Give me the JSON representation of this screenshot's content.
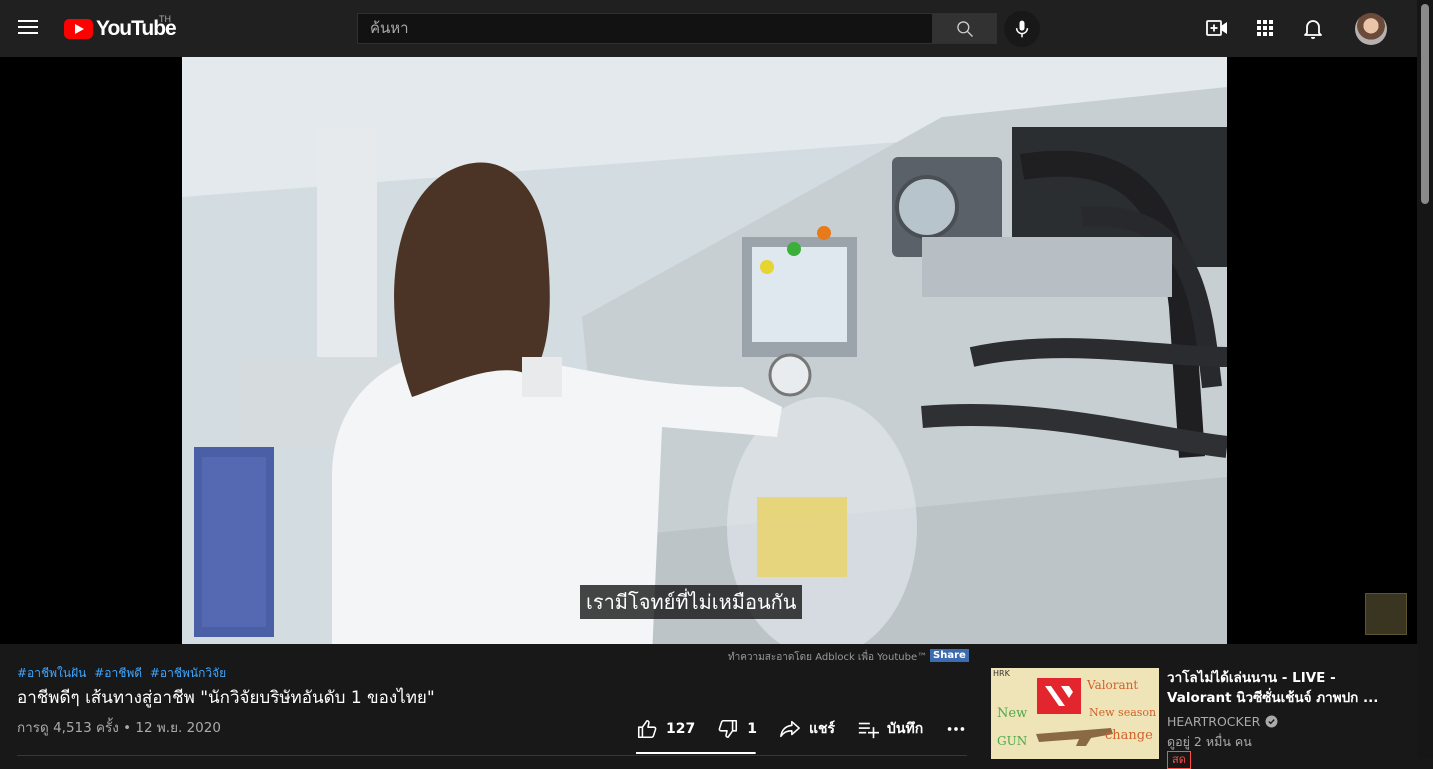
{
  "header": {
    "logo_text": "YouTube",
    "country_code": "TH",
    "search_placeholder": "ค้นหา"
  },
  "player": {
    "subtitle": "เรามีโจทย์ที่ไม่เหมือนกัน"
  },
  "adblock": {
    "text": "ทำความสะอาดโดย Adblock เพื่อ Youtube™",
    "share_label": "Share"
  },
  "video": {
    "hashtags": [
      "#อาชีพในฝัน",
      "#อาชีพดี",
      "#อาชีพนักวิจัย"
    ],
    "title": "อาชีพดีๆ เส้นทางสู่อาชีพ \"นักวิจัยบริษัทอันดับ 1 ของไทย\"",
    "meta": "การดู 4,513 ครั้ง • 12 พ.ย. 2020",
    "likes": "127",
    "dislikes": "1",
    "like_ratio": 0.99,
    "share_label": "แชร์",
    "save_label": "บันทึก"
  },
  "recommendation": {
    "title": "วาโลไม่ได้เล่นนาน - LIVE - Valorant นิวซีซั่นเช้นจ์ ภาพปก ...",
    "channel": "HEARTROCKER",
    "views": "ดูอยู่ 2 หมื่น คน",
    "badge": "สด",
    "thumb_corner": "HRK",
    "thumb_texts": [
      "Valorant",
      "New season",
      "change",
      "New",
      "GUN"
    ]
  },
  "colors": {
    "brand_red": "#ff0000",
    "link_blue": "#3ea6ff",
    "background": "#181818",
    "topbar": "#202020"
  }
}
